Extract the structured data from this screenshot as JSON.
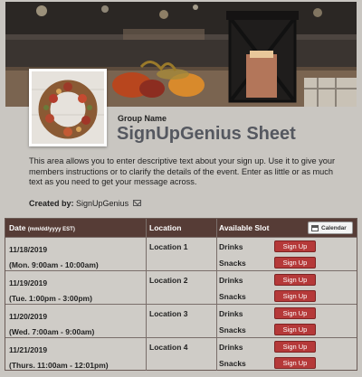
{
  "header": {
    "group_label": "Group Name",
    "title": "SignUpGenius Sheet"
  },
  "description": "This area allows you to enter descriptive text about your sign up. Use it to give your members instructions or to clarify the details of the event. Enter as little or as much text as you need to get your message across.",
  "created_by": {
    "label": "Created by:",
    "name": "SignUpGenius",
    "icon": "mail-icon"
  },
  "table": {
    "headers": {
      "date": "Date",
      "date_format": "(mm/dd/yyyy EST)",
      "location": "Location",
      "slot": "Available Slot",
      "calendar_button": "Calendar"
    },
    "rows": [
      {
        "date": "11/18/2019",
        "time": "(Mon. 9:00am - 10:00am)",
        "location": "Location 1",
        "slots": [
          "Drinks",
          "Snacks"
        ],
        "button": "Sign Up"
      },
      {
        "date": "11/19/2019",
        "time": "(Tue. 1:00pm - 3:00pm)",
        "location": "Location 2",
        "slots": [
          "Drinks",
          "Snacks"
        ],
        "button": "Sign Up"
      },
      {
        "date": "11/20/2019",
        "time": "(Wed. 7:00am - 9:00am)",
        "location": "Location 3",
        "slots": [
          "Drinks",
          "Snacks"
        ],
        "button": "Sign Up"
      },
      {
        "date": "11/21/2019",
        "time": "(Thurs. 11:00am - 12:01pm)",
        "location": "Location 4",
        "slots": [
          "Drinks",
          "Snacks"
        ],
        "button": "Sign Up"
      }
    ]
  },
  "colors": {
    "background": "#c9c6c1",
    "table_header": "#563c36",
    "signup_button": "#b53939",
    "title": "#555860"
  }
}
